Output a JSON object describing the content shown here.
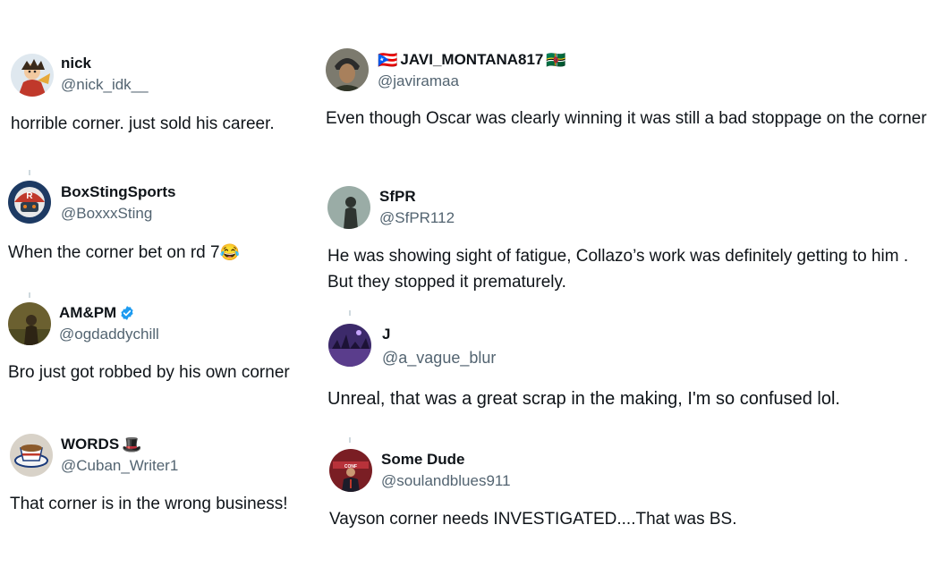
{
  "tweets": [
    {
      "name": "nick",
      "handle": "@nick_idk__",
      "text": "horrible corner. just sold his career.",
      "avatar_icon": "anime-character-avatar",
      "avatar_bg": "#c9d6e3"
    },
    {
      "name": "BoxStingSports",
      "handle": "@BoxxxSting",
      "text": "When the corner bet on rd 7",
      "emoji": "😂",
      "avatar_icon": "helmet-character-avatar",
      "avatar_bg": "#1d3a63"
    },
    {
      "name": "AM&PM",
      "handle": "@ogdaddychill",
      "text": "Bro just got robbed by his own corner",
      "verified": true,
      "avatar_icon": "person-photo-avatar",
      "avatar_bg": "#6b6030"
    },
    {
      "name": "WORDS",
      "handle": "@Cuban_Writer1",
      "text": "That corner is in the wrong business!",
      "emoji": "🎩",
      "avatar_icon": "coffee-cup-avatar",
      "avatar_bg": "#d8d2c8"
    },
    {
      "name": "JAVI_MONTANA817",
      "handle": "@javiramaa",
      "text": "Even though Oscar was clearly winning it was still a bad stoppage on the corner",
      "flag_before": "🇵🇷",
      "flag_after": "🇩🇲",
      "avatar_icon": "person-photo-avatar",
      "avatar_bg": "#4a4a3e"
    },
    {
      "name": "SfPR",
      "handle": "@SfPR112",
      "text": "He was showing sight of fatigue, Collazo’s work was definitely getting to him . But they stopped it prematurely.",
      "avatar_icon": "silhouette-avatar",
      "avatar_bg": "#8fa39c"
    },
    {
      "name": "J",
      "handle": "@a_vague_blur",
      "text": "Unreal, that was a great scrap in the making, I'm so confused lol.",
      "avatar_icon": "purple-city-avatar",
      "avatar_bg": "#3c2a6a"
    },
    {
      "name": "Some Dude",
      "handle": "@soulandblues911",
      "text": "Vayson corner needs INVESTIGATED....That was BS.",
      "avatar_icon": "press-conference-avatar",
      "avatar_bg": "#7a1e24"
    }
  ],
  "colors": {
    "text": "#0f1419",
    "secondary": "#536471",
    "verified": "#1d9bf0",
    "thread_line": "#cfd9de"
  }
}
